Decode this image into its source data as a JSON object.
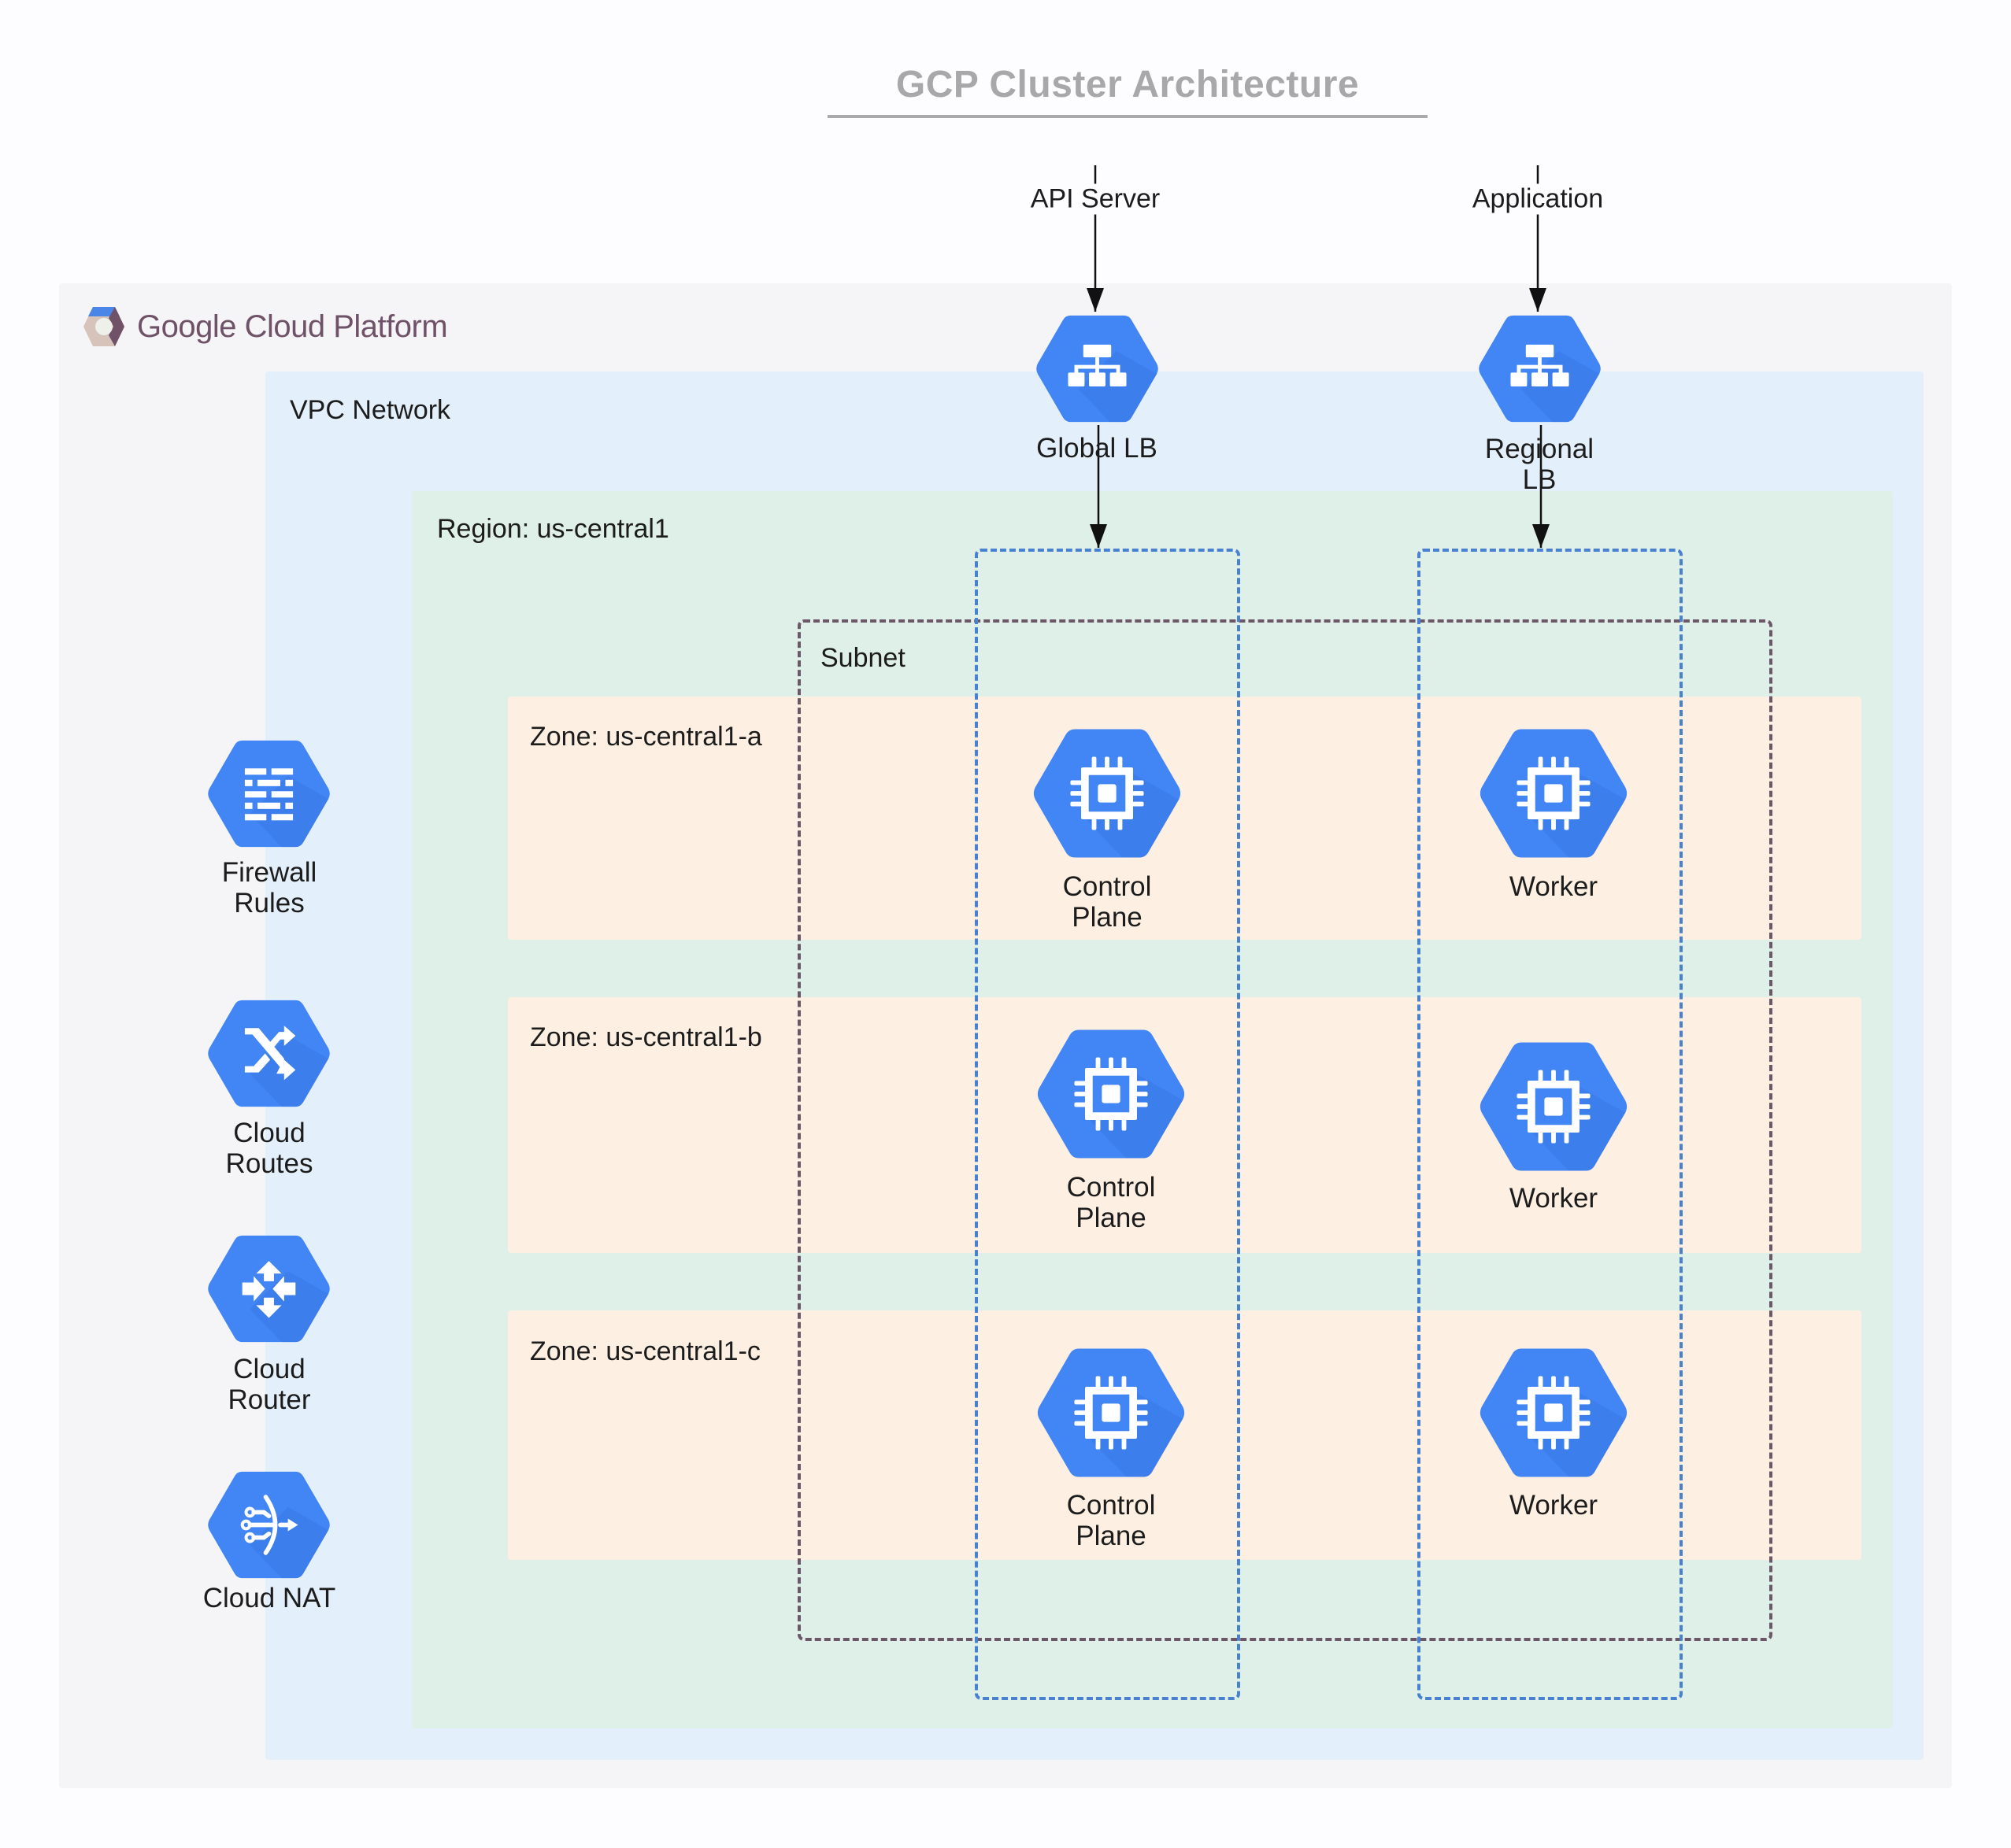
{
  "title": "GCP Cluster Architecture",
  "external": {
    "api_server": "API Server",
    "application": "Application"
  },
  "gcp": {
    "logo_text": "Google Cloud Platform"
  },
  "vpc": {
    "label": "VPC Network"
  },
  "region": {
    "label": "Region: us-central1"
  },
  "subnet": {
    "label": "Subnet"
  },
  "zones": [
    {
      "label": "Zone: us-central1-a"
    },
    {
      "label": "Zone: us-central1-b"
    },
    {
      "label": "Zone: us-central1-c"
    }
  ],
  "load_balancers": {
    "global": {
      "label": "Global LB",
      "icon": "load-balancer-icon"
    },
    "regional": {
      "label_line1": "Regional",
      "label_line2": "LB",
      "icon": "load-balancer-icon"
    }
  },
  "network_services": [
    {
      "label_line1": "Firewall",
      "label_line2": "Rules",
      "icon": "firewall-icon"
    },
    {
      "label_line1": "Cloud",
      "label_line2": "Routes",
      "icon": "routes-icon"
    },
    {
      "label_line1": "Cloud",
      "label_line2": "Router",
      "icon": "router-icon"
    },
    {
      "label_line1": "Cloud NAT",
      "label_line2": "",
      "icon": "nat-icon"
    }
  ],
  "control_plane": [
    {
      "label_line1": "Control",
      "label_line2": "Plane",
      "icon": "compute-engine-icon"
    },
    {
      "label_line1": "Control",
      "label_line2": "Plane",
      "icon": "compute-engine-icon"
    },
    {
      "label_line1": "Control",
      "label_line2": "Plane",
      "icon": "compute-engine-icon"
    }
  ],
  "workers": [
    {
      "label": "Worker",
      "icon": "compute-engine-icon"
    },
    {
      "label": "Worker",
      "icon": "compute-engine-icon"
    },
    {
      "label": "Worker",
      "icon": "compute-engine-icon"
    }
  ],
  "colors": {
    "hex_blue": "#4285f4",
    "hex_shadow": "#3b78e7",
    "instance_group_border": "#4a80d0",
    "subnet_border": "#6b5767",
    "gcp_bg": "#f5f4f7",
    "vpc_bg": "#e3effa",
    "region_bg": "#dff0e8",
    "zone_bg": "#fdf0e2",
    "title": "#a8a8aa"
  }
}
